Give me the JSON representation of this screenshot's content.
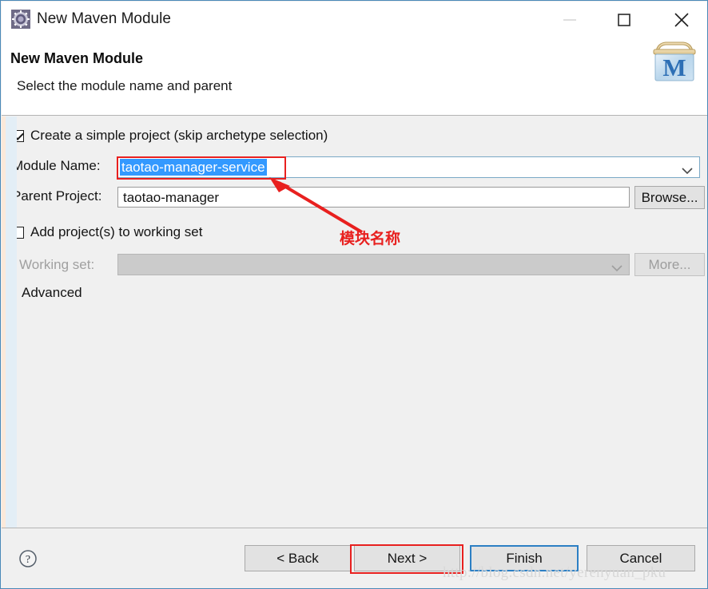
{
  "window": {
    "title": "New Maven Module",
    "icon": "maven-wizard-icon",
    "controls": {
      "minimize": "minimize-icon",
      "maximize": "maximize-icon",
      "close": "close-icon"
    }
  },
  "header": {
    "title": "New Maven Module",
    "subtitle": "Select the module name and parent",
    "logo": "maven-box-logo"
  },
  "form": {
    "simple_project": {
      "label": "Create a simple project (skip archetype selection)",
      "checked": true
    },
    "module_name": {
      "label": "Module Name:",
      "value": "taotao-manager-service",
      "selected": true,
      "dropdown_icon": "chevron-down-icon"
    },
    "parent_project": {
      "label": "Parent Project:",
      "value": "taotao-manager",
      "browse_label": "Browse..."
    },
    "add_to_working_set": {
      "label": "Add project(s) to working set",
      "checked": false
    },
    "working_set": {
      "label": "Working set:",
      "value": "",
      "disabled": true,
      "more_label": "More...",
      "dropdown_icon": "chevron-down-icon"
    },
    "advanced": {
      "label": "Advanced",
      "expander_icon": "triangle-right-icon",
      "expanded": false
    }
  },
  "footer": {
    "help_icon": "help-question-icon",
    "buttons": [
      {
        "label": "< Back",
        "name": "back-button",
        "state": "normal"
      },
      {
        "label": "Next >",
        "name": "next-button",
        "state": "normal"
      },
      {
        "label": "Finish",
        "name": "finish-button",
        "state": "default"
      },
      {
        "label": "Cancel",
        "name": "cancel-button",
        "state": "normal"
      }
    ]
  },
  "annotations": {
    "module_name_note": "模块名称",
    "highlight_color": "#e8201f",
    "arrow_icon": "red-arrow-icon"
  },
  "watermark": "http://blog.csdn.net/yerenyuan_pku"
}
